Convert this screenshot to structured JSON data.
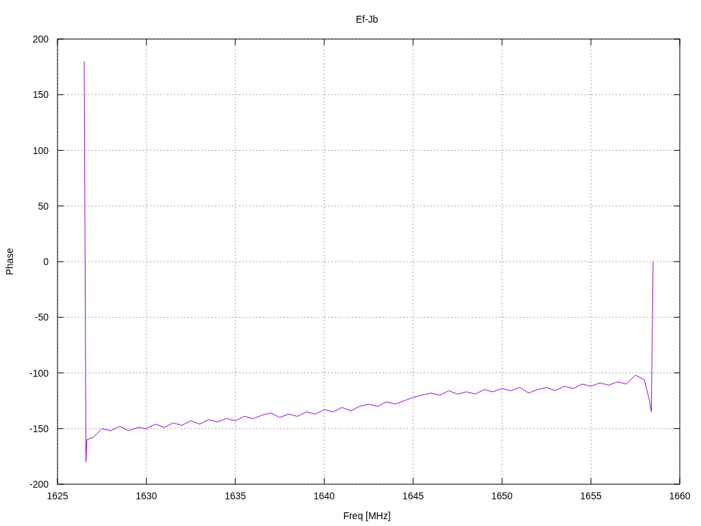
{
  "chart_data": {
    "type": "line",
    "title": "Ef-Jb",
    "xlabel": "Freq [MHz]",
    "ylabel": "Phase",
    "xlim": [
      1625,
      1660
    ],
    "ylim": [
      -200,
      200
    ],
    "xticks": [
      1625,
      1630,
      1635,
      1640,
      1645,
      1650,
      1655,
      1660
    ],
    "yticks": [
      -200,
      -150,
      -100,
      -50,
      0,
      50,
      100,
      150,
      200
    ],
    "grid": true,
    "x": [
      1626.5,
      1626.55,
      1626.6,
      1626.65,
      1627,
      1627.5,
      1628,
      1628.5,
      1629,
      1629.5,
      1630,
      1630.5,
      1631,
      1631.5,
      1632,
      1632.5,
      1633,
      1633.5,
      1634,
      1634.5,
      1635,
      1635.5,
      1636,
      1636.5,
      1637,
      1637.5,
      1638,
      1638.5,
      1639,
      1639.5,
      1640,
      1640.5,
      1641,
      1641.5,
      1642,
      1642.5,
      1643,
      1643.5,
      1644,
      1644.5,
      1645,
      1645.5,
      1646,
      1646.5,
      1647,
      1647.5,
      1648,
      1648.5,
      1649,
      1649.5,
      1650,
      1650.5,
      1651,
      1651.5,
      1652,
      1652.5,
      1653,
      1653.5,
      1654,
      1654.5,
      1655,
      1655.5,
      1656,
      1656.5,
      1657,
      1657.5,
      1658,
      1658.3,
      1658.4,
      1658.45,
      1658.5
    ],
    "series": [
      {
        "color": "#9400d3",
        "values": [
          180,
          0,
          -180,
          -160,
          -158,
          -150,
          -152,
          -148,
          -152,
          -149,
          -150,
          -146,
          -149,
          -145,
          -147,
          -143,
          -146,
          -142,
          -144,
          -141,
          -143,
          -139,
          -141,
          -138,
          -136,
          -140,
          -137,
          -139,
          -135,
          -137,
          -133,
          -135,
          -131,
          -134,
          -130,
          -128,
          -130,
          -126,
          -128,
          -125,
          -122,
          -120,
          -118,
          -120,
          -116,
          -119,
          -117,
          -119,
          -115,
          -117,
          -114,
          -116,
          -113,
          -118,
          -115,
          -113,
          -116,
          -112,
          -114,
          -110,
          -112,
          -109,
          -111,
          -108,
          -110,
          -102,
          -106,
          -125,
          -135,
          -70,
          0
        ]
      }
    ]
  }
}
